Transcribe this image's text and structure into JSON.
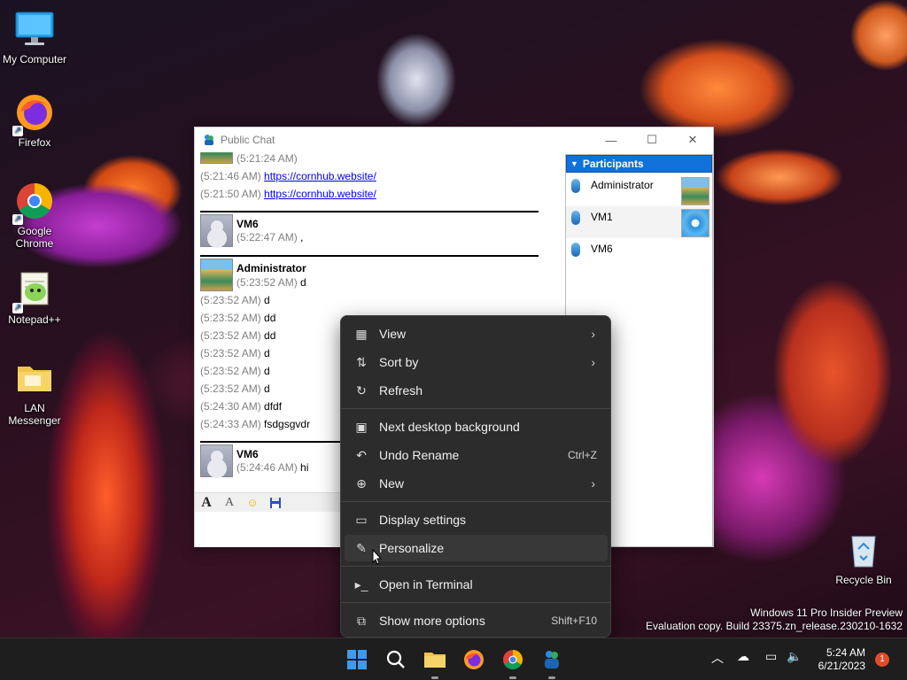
{
  "desktop": {
    "icons": [
      {
        "label": "My Computer"
      },
      {
        "label": "Firefox"
      },
      {
        "label": "Google Chrome"
      },
      {
        "label": "Notepad++"
      },
      {
        "label": "LAN Messenger"
      },
      {
        "label": "Recycle Bin"
      }
    ],
    "watermark": {
      "line1": "Windows 11 Pro Insider Preview",
      "line2": "Evaluation copy. Build 23375.zn_release.230210-1632"
    }
  },
  "chat_window": {
    "title": "Public Chat",
    "messages": [
      {
        "ts": "(5:21:24 AM)",
        "text": ""
      },
      {
        "ts": "(5:21:46 AM)",
        "link": "https://cornhub.website/"
      },
      {
        "ts": "(5:21:50 AM)",
        "link": "https://cornhub.website/"
      },
      {
        "sender": "VM6",
        "ts": "(5:22:47 AM)",
        "text": ","
      },
      {
        "sender": "Administrator",
        "ts": "(5:23:52 AM)",
        "text": "d"
      },
      {
        "ts": "(5:23:52 AM)",
        "text": "d"
      },
      {
        "ts": "(5:23:52 AM)",
        "text": "dd"
      },
      {
        "ts": "(5:23:52 AM)",
        "text": "dd"
      },
      {
        "ts": "(5:23:52 AM)",
        "text": "d"
      },
      {
        "ts": "(5:23:52 AM)",
        "text": "d"
      },
      {
        "ts": "(5:23:52 AM)",
        "text": "d"
      },
      {
        "ts": "(5:24:30 AM)",
        "text": "dfdf"
      },
      {
        "ts": "(5:24:33 AM)",
        "text": "fsdgsgvdr"
      },
      {
        "sender": "VM6",
        "ts": "(5:24:46 AM)",
        "text": "hi"
      }
    ],
    "participants": {
      "header": "Participants",
      "list": [
        {
          "name": "Administrator"
        },
        {
          "name": "VM1"
        },
        {
          "name": "VM6"
        }
      ]
    }
  },
  "context_menu": {
    "items": [
      {
        "label": "View",
        "icon": "grid-icon",
        "submenu": true
      },
      {
        "label": "Sort by",
        "icon": "sort-icon",
        "submenu": true
      },
      {
        "label": "Refresh",
        "icon": "refresh-icon"
      },
      {
        "label": "Next desktop background",
        "icon": "background-icon"
      },
      {
        "label": "Undo Rename",
        "icon": "undo-icon",
        "shortcut": "Ctrl+Z"
      },
      {
        "label": "New",
        "icon": "plus-circle-icon",
        "submenu": true
      },
      {
        "label": "Display settings",
        "icon": "display-icon"
      },
      {
        "label": "Personalize",
        "icon": "brush-icon"
      },
      {
        "label": "Open in Terminal",
        "icon": "terminal-icon"
      },
      {
        "label": "Show more options",
        "icon": "more-options-icon",
        "shortcut": "Shift+F10"
      }
    ]
  },
  "taskbar": {
    "clock_time": "5:24 AM",
    "clock_date": "6/21/2023",
    "notification_count": "1"
  }
}
